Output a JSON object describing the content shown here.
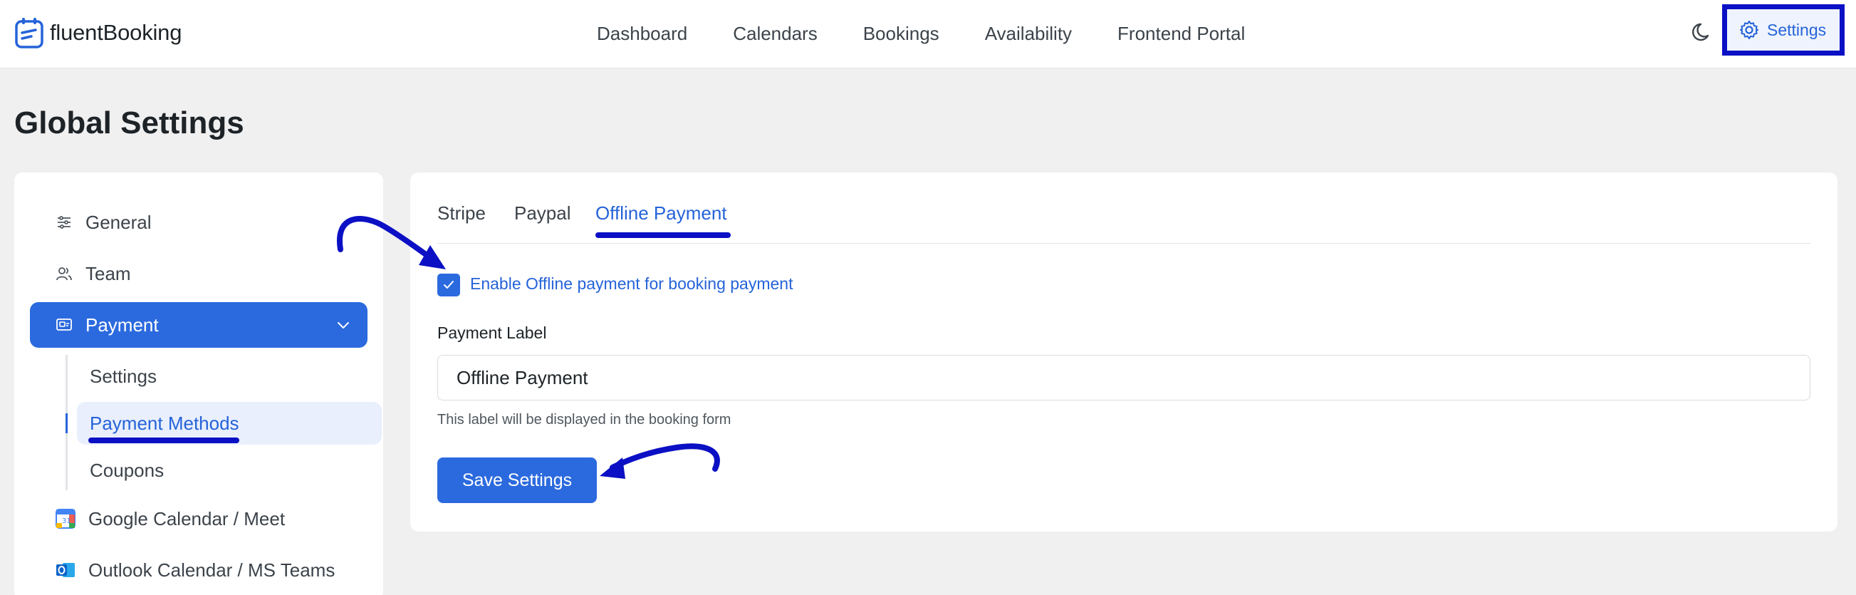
{
  "header": {
    "logo_light": "fluent",
    "logo_bold": "Booking",
    "nav": [
      "Dashboard",
      "Calendars",
      "Bookings",
      "Availability",
      "Frontend Portal"
    ],
    "theme_icon": "moon-icon",
    "settings_label": "Settings",
    "settings_icon": "gear-icon"
  },
  "page": {
    "title": "Global Settings"
  },
  "sidebar": {
    "items": [
      {
        "label": "General",
        "icon": "sliders-icon"
      },
      {
        "label": "Team",
        "icon": "users-icon"
      },
      {
        "label": "Payment",
        "icon": "payment-icon"
      },
      {
        "label": "Google Calendar / Meet",
        "icon": "google-calendar-icon"
      },
      {
        "label": "Outlook Calendar / MS Teams",
        "icon": "outlook-icon"
      }
    ],
    "payment_sub": [
      "Settings",
      "Payment Methods",
      "Coupons"
    ]
  },
  "main": {
    "tabs": [
      "Stripe",
      "Paypal",
      "Offline Payment"
    ],
    "active_tab": "Offline Payment",
    "enable_checkbox_label": "Enable Offline payment for booking payment",
    "enable_checked": true,
    "field_label": "Payment Label",
    "field_value": "Offline Payment",
    "help_text": "This label will be displayed in the booking form",
    "save_label": "Save Settings"
  },
  "colors": {
    "accent": "#2b6ade",
    "annotation": "#0b10c4",
    "background": "#f0f0f1"
  }
}
